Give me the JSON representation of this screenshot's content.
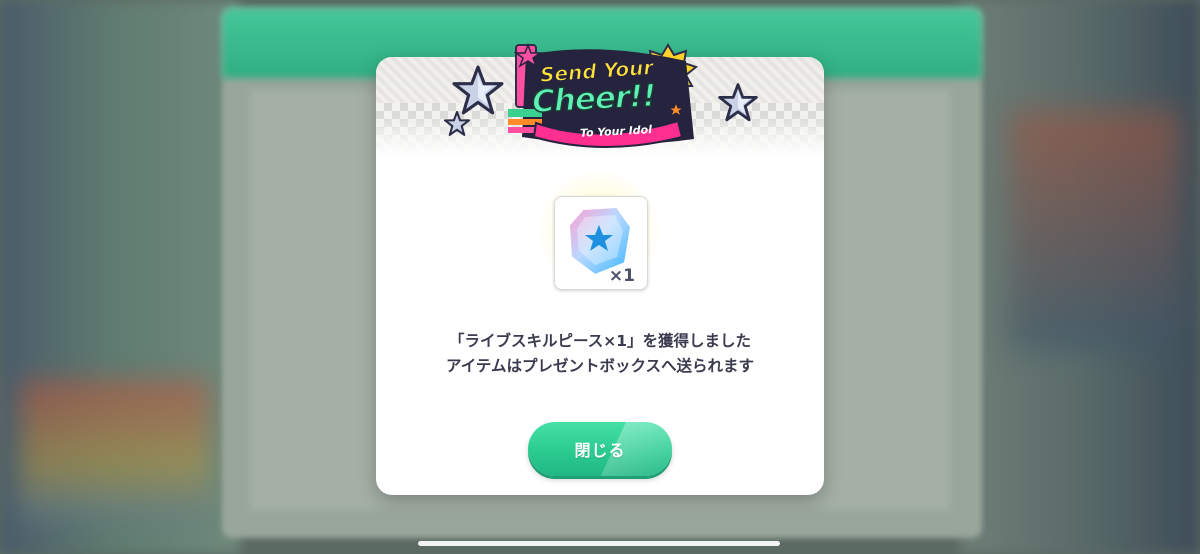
{
  "logo": {
    "line1": "Send Your",
    "line2": "Cheer!!",
    "line3": "To Your Idol"
  },
  "item": {
    "name": "ライブスキルピース",
    "icon": "crystal-star-icon",
    "quantity": "×1"
  },
  "message": {
    "line1": "「ライブスキルピース×1」を獲得しました",
    "line2": "アイテムはプレゼントボックスへ送られます"
  },
  "close_button": {
    "label": "閉じる",
    "color": "#2fd091"
  },
  "colors": {
    "dialog_bg": "#ffffff",
    "text": "#3b3b4f",
    "button": "#2fd091"
  }
}
